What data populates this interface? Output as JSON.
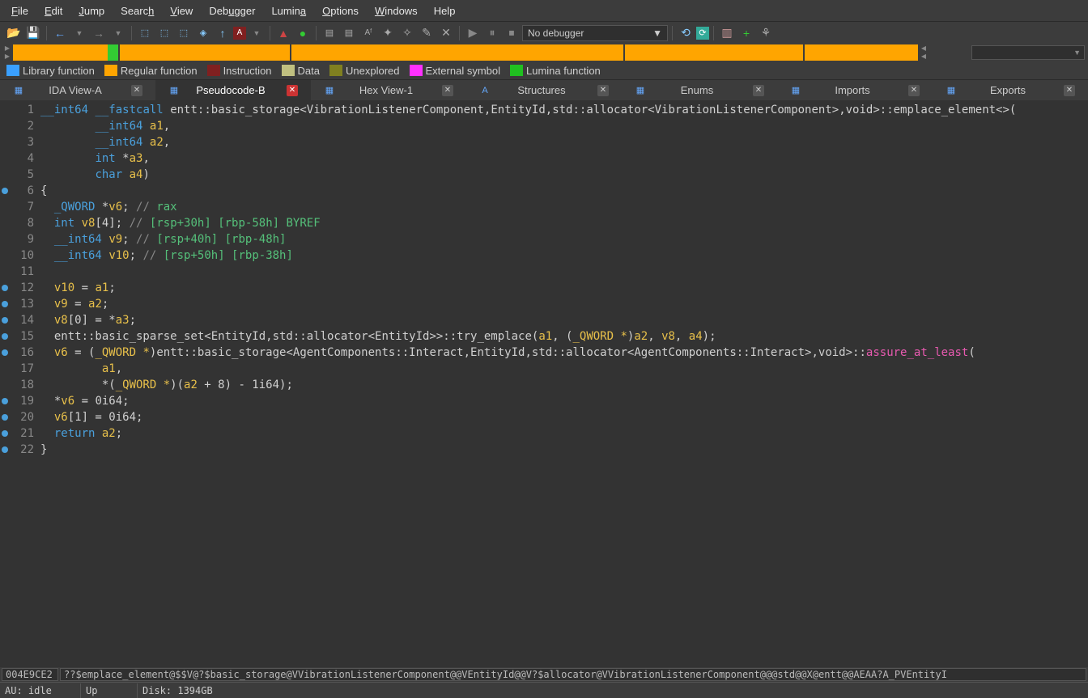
{
  "menu": [
    "File",
    "Edit",
    "Jump",
    "Search",
    "View",
    "Debugger",
    "Lumina",
    "Options",
    "Windows",
    "Help"
  ],
  "debugger_combo": "No debugger",
  "legend": [
    {
      "color": "#3aa0ff",
      "label": "Library function"
    },
    {
      "color": "#ffa500",
      "label": "Regular function"
    },
    {
      "color": "#802020",
      "label": "Instruction"
    },
    {
      "color": "#c0c080",
      "label": "Data"
    },
    {
      "color": "#808020",
      "label": "Unexplored"
    },
    {
      "color": "#ff30ff",
      "label": "External symbol"
    },
    {
      "color": "#20c020",
      "label": "Lumina function"
    }
  ],
  "tabs": [
    {
      "label": "IDA View-A",
      "active": false
    },
    {
      "label": "Pseudocode-B",
      "active": true
    },
    {
      "label": "Hex View-1",
      "active": false
    },
    {
      "label": "Structures",
      "active": false
    },
    {
      "label": "Enums",
      "active": false
    },
    {
      "label": "Imports",
      "active": false
    },
    {
      "label": "Exports",
      "active": false
    }
  ],
  "code": {
    "lines": [
      {
        "n": 1,
        "dot": false,
        "html": "<span class='c-type'>__int64</span> <span class='c-type'>__fastcall</span> <span class='c-func'>entt::basic_storage&lt;VibrationListenerComponent,EntityId,std::allocator&lt;VibrationListenerComponent&gt;,void&gt;::emplace_element&lt;&gt;</span>("
      },
      {
        "n": 2,
        "dot": false,
        "html": "        <span class='c-type'>__int64</span> <span class='c-link'>a1</span>,"
      },
      {
        "n": 3,
        "dot": false,
        "html": "        <span class='c-type'>__int64</span> <span class='c-link'>a2</span>,"
      },
      {
        "n": 4,
        "dot": false,
        "html": "        <span class='c-type'>int</span> *<span class='c-link'>a3</span>,"
      },
      {
        "n": 5,
        "dot": false,
        "html": "        <span class='c-type'>char</span> <span class='c-link'>a4</span>)"
      },
      {
        "n": 6,
        "dot": true,
        "html": "{"
      },
      {
        "n": 7,
        "dot": false,
        "html": "  <span class='c-type'>_QWORD</span> *<span class='c-link'>v6</span>; <span class='c-comment'>//</span> <span class='c-comment-ref'>rax</span>"
      },
      {
        "n": 8,
        "dot": false,
        "html": "  <span class='c-type'>int</span> <span class='c-link'>v8</span>[4]; <span class='c-comment'>//</span> <span class='c-comment-ref'>[rsp+30h] [rbp-58h] BYREF</span>"
      },
      {
        "n": 9,
        "dot": false,
        "html": "  <span class='c-type'>__int64</span> <span class='c-link'>v9</span>; <span class='c-comment'>//</span> <span class='c-comment-ref'>[rsp+40h] [rbp-48h]</span>"
      },
      {
        "n": 10,
        "dot": false,
        "html": "  <span class='c-type'>__int64</span> <span class='c-link'>v10</span>; <span class='c-comment'>//</span> <span class='c-comment-ref'>[rsp+50h] [rbp-38h]</span>"
      },
      {
        "n": 11,
        "dot": false,
        "html": ""
      },
      {
        "n": 12,
        "dot": true,
        "html": "  <span class='c-link'>v10</span> = <span class='c-link'>a1</span>;"
      },
      {
        "n": 13,
        "dot": true,
        "html": "  <span class='c-link'>v9</span> = <span class='c-link'>a2</span>;"
      },
      {
        "n": 14,
        "dot": true,
        "html": "  <span class='c-link'>v8</span>[0] = *<span class='c-link'>a3</span>;"
      },
      {
        "n": 15,
        "dot": true,
        "html": "  <span class='c-func'>entt::basic_sparse_set&lt;EntityId,std::allocator&lt;EntityId&gt;&gt;::try_emplace</span>(<span class='c-link'>a1</span>, (<span class='c-cast'>_QWORD *</span>)<span class='c-link'>a2</span>, <span class='c-link'>v8</span>, <span class='c-link'>a4</span>);"
      },
      {
        "n": 16,
        "dot": true,
        "html": "  <span class='c-link'>v6</span> = (<span class='c-cast'>_QWORD *</span>)<span class='c-func'>entt::basic_storage&lt;AgentComponents::Interact,EntityId,std::allocator&lt;AgentComponents::Interact&gt;,void&gt;::</span><span class='c-link2'>assure_at_least</span>("
      },
      {
        "n": 17,
        "dot": false,
        "html": "         <span class='c-link'>a1</span>,"
      },
      {
        "n": 18,
        "dot": false,
        "html": "         *(<span class='c-cast'>_QWORD *</span>)(<span class='c-link'>a2</span> + 8) - 1i64);"
      },
      {
        "n": 19,
        "dot": true,
        "html": "  *<span class='c-link'>v6</span> = 0i64;"
      },
      {
        "n": 20,
        "dot": true,
        "html": "  <span class='c-link'>v6</span>[1] = 0i64;"
      },
      {
        "n": 21,
        "dot": true,
        "html": "  <span class='c-kw'>return</span> <span class='c-link'>a2</span>;"
      },
      {
        "n": 22,
        "dot": true,
        "html": "}"
      }
    ]
  },
  "addr_bar": {
    "addr": "004E9CE2",
    "symbol": "??$emplace_element@$$V@?$basic_storage@VVibrationListenerComponent@@VEntityId@@V?$allocator@VVibrationListenerComponent@@@std@@X@entt@@AEAA?A_PVEntityI"
  },
  "status": {
    "au": "AU:  idle",
    "mode": "Up",
    "disk": "Disk: 1394GB"
  }
}
